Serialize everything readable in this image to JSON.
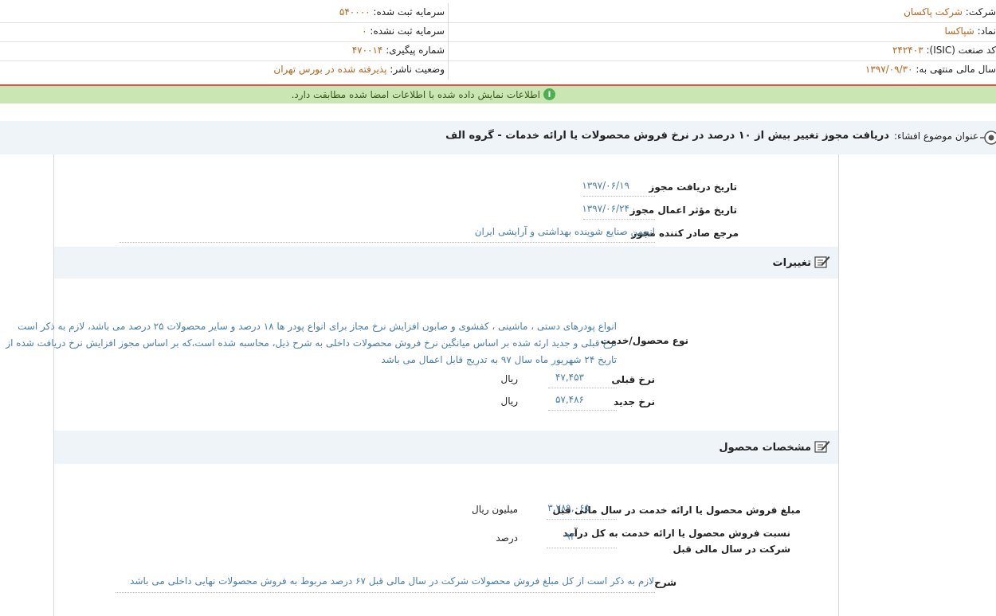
{
  "company_info": {
    "company_label": "شرکت:",
    "company_value": "شرکت پاکسان",
    "symbol_label": "نماد:",
    "symbol_value": "شپاکسا",
    "isic_label": "کد صنعت (ISIC):",
    "isic_value": "۲۴۲۴۰۳",
    "fiscal_label": "سال مالی منتهی به:",
    "fiscal_value": "۱۳۹۷/۰۹/۳۰",
    "registered_capital_label": "سرمایه ثبت شده:",
    "registered_capital_value": "۵۴۰۰۰۰",
    "unregistered_capital_label": "سرمایه ثبت نشده:",
    "unregistered_capital_value": "۰",
    "tracking_label": "شماره پیگیری:",
    "tracking_value": "۴۷۰۰۱۴",
    "publisher_status_label": "وضعیت ناشر:",
    "publisher_status_value": "پذیرفته شده در بورس تهران"
  },
  "info_banner": {
    "text": "اطلاعات نمایش داده شده با اطلاعات امضا شده مطابقت دارد.",
    "icon": "info-icon",
    "color": "#c9e6b3"
  },
  "disclosure": {
    "subject_label": "عنوان موضوع افشاء:",
    "subject_value": "دریافت مجوز تغییر بیش از ۱۰ درصد در نرخ فروش محصولات یا ارائه خدمات - گروه الف"
  },
  "permit": {
    "receive_date_label": "تاریخ دریافت مجوز",
    "receive_date_value": "۱۳۹۷/۰۶/۱۹",
    "effective_date_label": "تاریخ مؤثر اعمال مجوز",
    "effective_date_value": "۱۳۹۷/۰۶/۲۴",
    "issuer_label": "مرجع صادر کننده مجوز",
    "issuer_value": "انجمن صنایع شوینده بهداشتی و آرایشی ایران"
  },
  "changes": {
    "title": "تغییرات",
    "product_label": "نوع محصول/خدمت",
    "product_lines": [
      "انواع پودرهای دستی ، ماشینی ، کفشوی و صابون افزایش نرخ مجاز برای انواع پودر ها ۱۸ درصد و سایر محصولات ۲۵ درصد می باشد، لازم به ذکر است",
      "نرخ قبلی و جدید ارئه شده بر اساس میانگین نرخ فروش محصولات داخلی به شرح ذیل، محاسبه شده است،که بر اساس مجوز افزایش نرخ دریافت شده از",
      "تاریخ ۲۴ شهریور ماه سال ۹۷ به تدریج قابل اعمال می باشد"
    ],
    "old_rate_label": "نرخ قبلی",
    "old_rate_value": "۴۷,۴۵۳",
    "old_rate_unit": "ریال",
    "new_rate_label": "نرخ جدید",
    "new_rate_value": "۵۷,۴۸۶",
    "new_rate_unit": "ریال"
  },
  "product_specs": {
    "title": "مشخصات محصول",
    "sales_label": "مبلغ فروش محصول یا ارائه خدمت در سال مالی قبل",
    "sales_value": "۳,۷۸۹,۰۶۵",
    "sales_unit": "میلیون ریال",
    "ratio_label_line1": "نسبت فروش محصول یا ارائه خدمت به کل درآمد",
    "ratio_label_line2": "شرکت در سال مالی قبل",
    "ratio_value": "۹۴",
    "ratio_unit": "درصد",
    "desc_label": "شرح",
    "desc_value": "لازم به ذکر است از کل مبلغ فروش محصولات شرکت در سال مالی قبل ۶۷ درصد مربوط به فروش محصولات نهایی داخلی می باشد"
  },
  "colors": {
    "value_orange": "#b5651d",
    "value_blue": "#4a7fa6",
    "banner_green": "#c9e6b3",
    "section_bg": "#eef4f8",
    "divider_red": "#d9534f"
  }
}
